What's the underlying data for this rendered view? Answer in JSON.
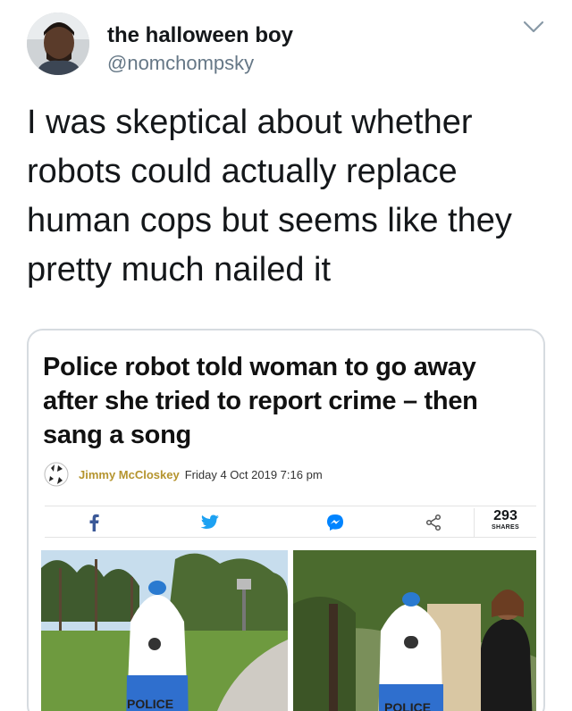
{
  "tweet": {
    "display_name": "the halloween boy",
    "handle": "@nomchompsky",
    "text": "I was skeptical about whether robots could actually replace human cops but seems like they pretty much nailed it"
  },
  "article": {
    "headline": "Police robot told woman to go away after she tried to report crime – then sang a song",
    "author": "Jimmy McCloskey",
    "date": "Friday 4 Oct 2019 7:16 pm",
    "share_count": "293",
    "share_label": "SHARES",
    "robot_label_left": "POLICE",
    "robot_label_right": "POLICE"
  },
  "icons": {
    "menu": "chevron-down-icon",
    "facebook": "facebook-icon",
    "twitter": "twitter-icon",
    "messenger": "messenger-icon",
    "share": "share-icon"
  },
  "colors": {
    "text": "#14171a",
    "handle": "#657786",
    "author": "#b5942e",
    "facebook": "#3b5998",
    "twitter": "#1da1f2",
    "messenger": "#0084ff"
  }
}
